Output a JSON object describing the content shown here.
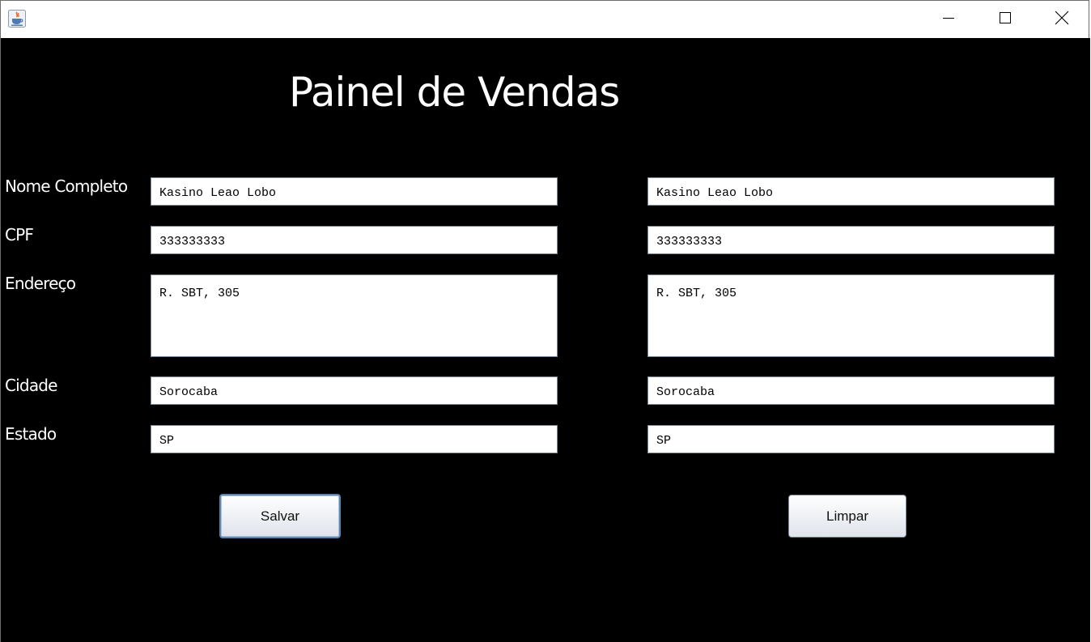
{
  "window": {
    "icon": "java-cup-icon",
    "controls": [
      "minimize-icon",
      "maximize-icon",
      "close-icon"
    ]
  },
  "panel": {
    "title": "Painel de Vendas"
  },
  "labels": {
    "nome": "Nome Completo",
    "cpf": "CPF",
    "endereco": "Endereço",
    "cidade": "Cidade",
    "estado": "Estado"
  },
  "form_left": {
    "nome": "Kasino Leao Lobo",
    "cpf": "333333333",
    "endereco": "R. SBT, 305",
    "cidade": "Sorocaba",
    "estado": "SP"
  },
  "form_right": {
    "nome": "Kasino Leao Lobo",
    "cpf": "333333333",
    "endereco": "R. SBT, 305",
    "cidade": "Sorocaba",
    "estado": "SP"
  },
  "buttons": {
    "salvar": "Salvar",
    "limpar": "Limpar"
  },
  "colors": {
    "background": "#000000",
    "text": "#ffffff",
    "field_background": "#ffffff"
  }
}
